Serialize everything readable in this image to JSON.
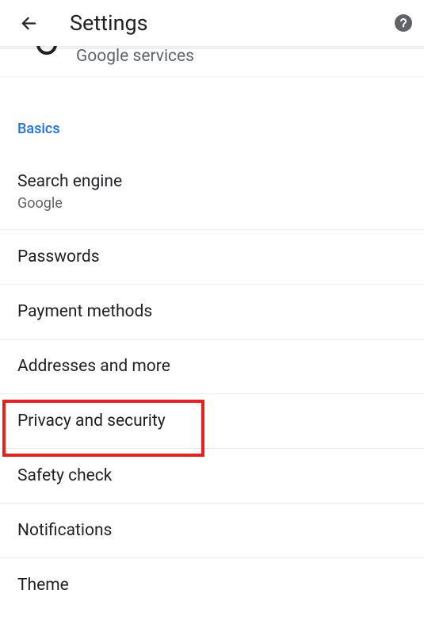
{
  "header": {
    "title": "Settings"
  },
  "truncated_item": {
    "label": "Google services"
  },
  "section": {
    "label": "Basics"
  },
  "items": [
    {
      "title": "Search engine",
      "sub": "Google"
    },
    {
      "title": "Passwords"
    },
    {
      "title": "Payment methods"
    },
    {
      "title": "Addresses and more"
    },
    {
      "title": "Privacy and security"
    },
    {
      "title": "Safety check"
    },
    {
      "title": "Notifications"
    },
    {
      "title": "Theme"
    }
  ]
}
